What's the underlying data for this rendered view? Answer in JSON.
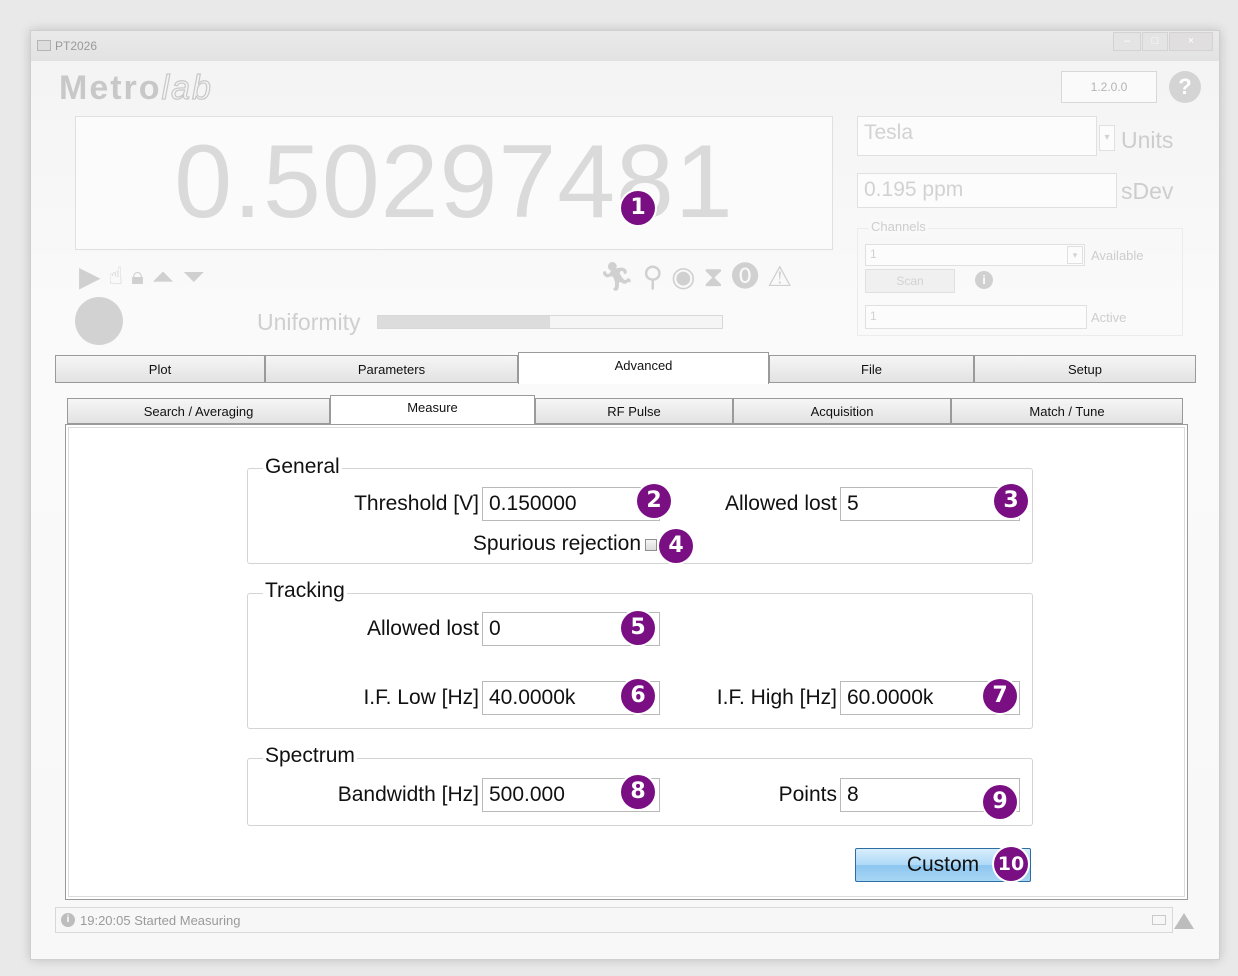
{
  "window": {
    "title": "PT2026",
    "version": "1.2.0.0",
    "logo_main": "Metro",
    "logo_script": "lab",
    "help": "?"
  },
  "readout": {
    "value": "0.50297481"
  },
  "status_icons": [
    "play-icon",
    "hand-pointer-icon",
    "lock-icon",
    "arrow-up-icon",
    "arrow-down-icon",
    "running-man-icon",
    "magnifier-icon",
    "gauge-icon",
    "hourglass-icon",
    "exclamation-circle-icon",
    "warning-triangle-icon"
  ],
  "uniformity": {
    "label": "Uniformity",
    "level_fraction": 0.5
  },
  "right_panel": {
    "units_value": "Tesla",
    "units_label": "Units",
    "sdev_value": "0.195 ppm",
    "sdev_label": "sDev",
    "channels_label": "Channels",
    "available_value": "1",
    "available_label": "Available",
    "scan_label": "Scan",
    "active_value": "1",
    "active_label": "Active"
  },
  "tabs": [
    "Plot",
    "Parameters",
    "Advanced",
    "File",
    "Setup"
  ],
  "active_tab": "Advanced",
  "subtabs": [
    "Search / Averaging",
    "Measure",
    "RF Pulse",
    "Acquisition",
    "Match / Tune"
  ],
  "active_subtab": "Measure",
  "general": {
    "title": "General",
    "threshold_label": "Threshold [V]",
    "threshold_value": "0.150000",
    "allowed_lost_label": "Allowed lost",
    "allowed_lost_value": "5",
    "spurious_label": "Spurious rejection"
  },
  "tracking": {
    "title": "Tracking",
    "allowed_lost_label": "Allowed lost",
    "allowed_lost_value": "0",
    "if_low_label": "I.F. Low [Hz]",
    "if_low_value": "40.0000k",
    "if_high_label": "I.F. High [Hz]",
    "if_high_value": "60.0000k"
  },
  "spectrum": {
    "title": "Spectrum",
    "bandwidth_label": "Bandwidth [Hz]",
    "bandwidth_value": "500.000",
    "points_label": "Points",
    "points_value": "8"
  },
  "custom_button": "Custom",
  "badges": [
    "1",
    "2",
    "3",
    "4",
    "5",
    "6",
    "7",
    "8",
    "9",
    "10"
  ],
  "statusbar": {
    "icon": "i",
    "text": "19:20:05 Started Measuring"
  },
  "colors": {
    "badge": "#7a0e83",
    "button_blue": "#a9d6f5"
  }
}
